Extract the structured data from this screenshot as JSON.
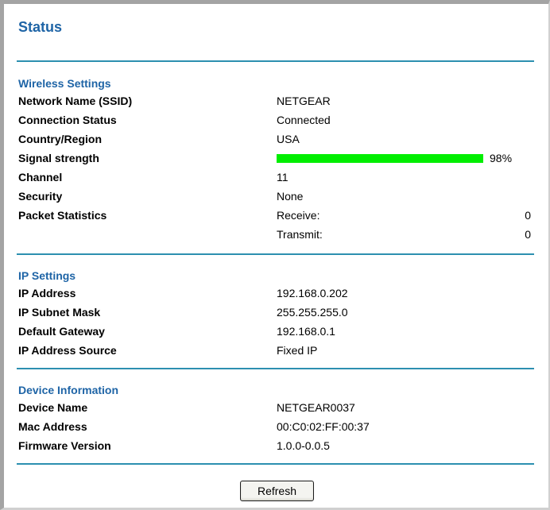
{
  "page": {
    "title": "Status"
  },
  "wireless": {
    "heading": "Wireless Settings",
    "ssid": {
      "label": "Network Name (SSID)",
      "value": "NETGEAR"
    },
    "connection": {
      "label": "Connection Status",
      "value": "Connected"
    },
    "country": {
      "label": "Country/Region",
      "value": "USA"
    },
    "signal": {
      "label": "Signal strength",
      "value": 0.98,
      "text": "98%",
      "bar_color": "#00ee00"
    },
    "channel": {
      "label": "Channel",
      "value": "11"
    },
    "security": {
      "label": "Security",
      "value": "None"
    },
    "packets": {
      "label": "Packet Statistics",
      "receive_label": "Receive:",
      "receive_value": "0",
      "transmit_label": "Transmit:",
      "transmit_value": "0"
    }
  },
  "ip": {
    "heading": "IP Settings",
    "address": {
      "label": "IP Address",
      "value": "192.168.0.202"
    },
    "mask": {
      "label": "IP Subnet Mask",
      "value": "255.255.255.0"
    },
    "gateway": {
      "label": "Default Gateway",
      "value": "192.168.0.1"
    },
    "source": {
      "label": "IP Address Source",
      "value": "Fixed IP"
    }
  },
  "device": {
    "heading": "Device Information",
    "name": {
      "label": "Device Name",
      "value": "NETGEAR0037"
    },
    "mac": {
      "label": "Mac Address",
      "value": "00:C0:02:FF:00:37"
    },
    "firmware": {
      "label": "Firmware Version",
      "value": "1.0.0-0.0.5"
    }
  },
  "actions": {
    "refresh_label": "Refresh"
  },
  "colors": {
    "heading": "#1e64a6",
    "divider": "#2c8fb0",
    "signal": "#00ee00"
  }
}
